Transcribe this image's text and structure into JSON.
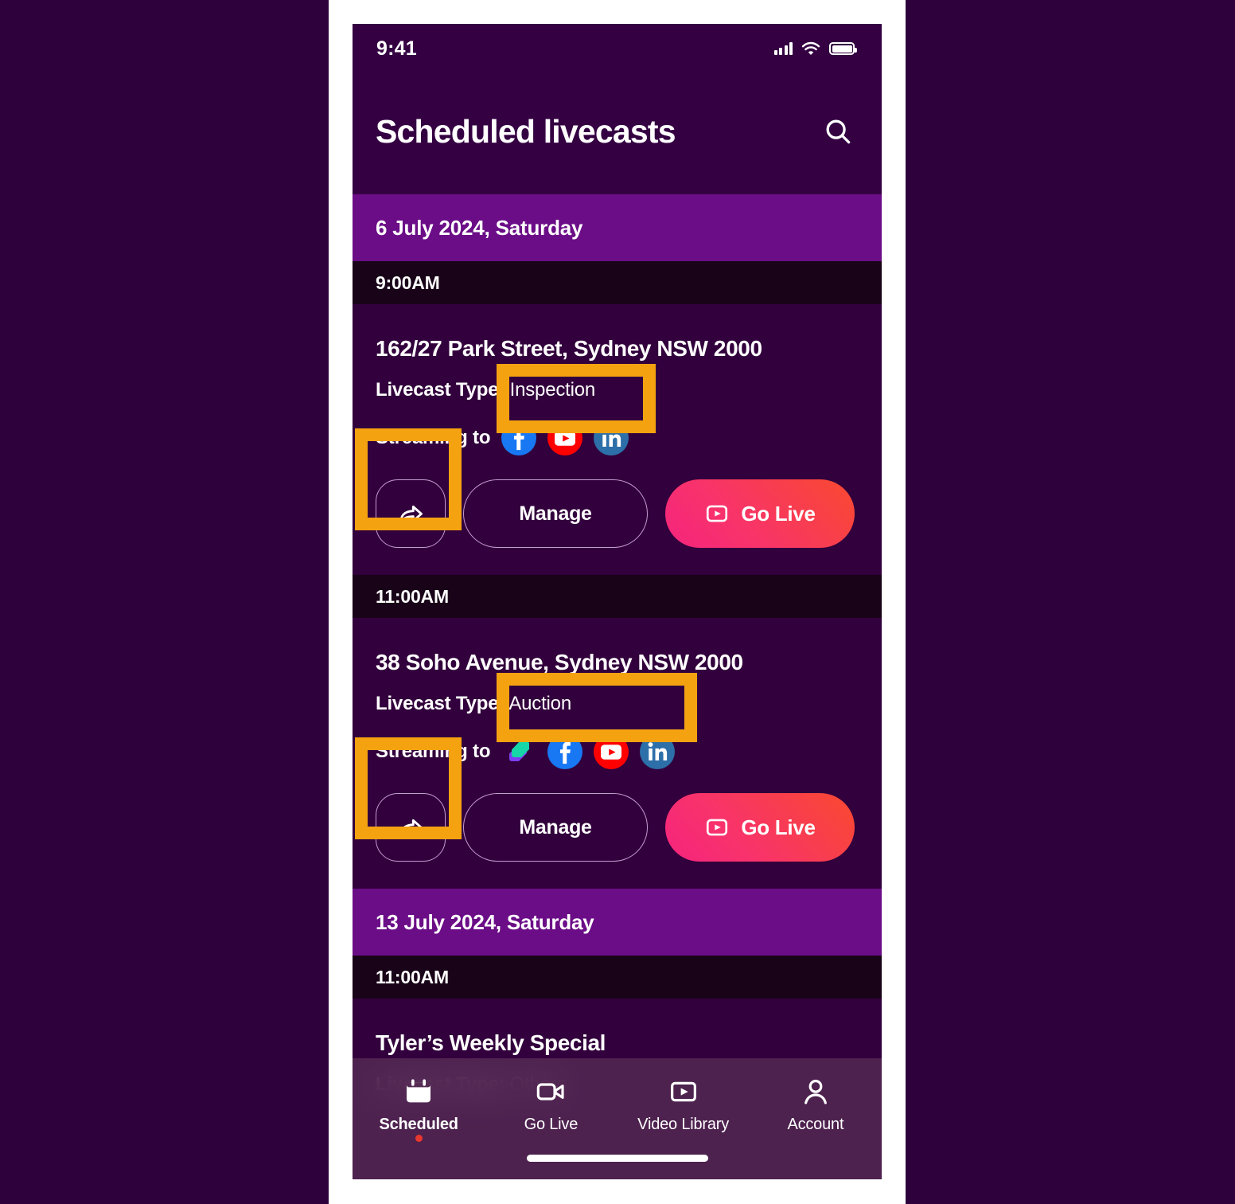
{
  "status_bar": {
    "time": "9:41",
    "cellular_icon": "signal-bars-icon",
    "wifi_icon": "wifi-icon",
    "battery_icon": "battery-full-icon"
  },
  "header": {
    "title": "Scheduled livecasts",
    "search_icon": "search-icon"
  },
  "colors": {
    "page_background": "#2E003C",
    "screen_background": "#32003C",
    "header_background": "#340042",
    "date_header_background": "#6B0D87",
    "time_row_background": "#190318",
    "accent_gradient_start": "#F5247E",
    "accent_gradient_end": "#F9492F",
    "annotation_highlight": "#F5A210",
    "badge_dot": "#E8382E",
    "facebook": "#1877F2",
    "youtube": "#FF0000",
    "linkedin": "#2D6FA8"
  },
  "sections": [
    {
      "date": "6 July 2024, Saturday",
      "entries": [
        {
          "time": "9:00AM",
          "title": "162/27 Park Street, Sydney NSW 2000",
          "type_label": "Livecast Type:",
          "type_value": "Inspection",
          "streaming_label": "Streaming to",
          "platforms": [
            "facebook",
            "youtube",
            "linkedin"
          ],
          "share_icon": "share-arrow-icon",
          "manage_label": "Manage",
          "golive_label": "Go Live",
          "golive_icon": "play-box-icon"
        },
        {
          "time": "11:00AM",
          "title": "38 Soho Avenue, Sydney NSW 2000",
          "type_label": "Livecast Type:",
          "type_value": "Auction",
          "streaming_label": "Streaming to",
          "platforms": [
            "domain",
            "facebook",
            "youtube",
            "linkedin"
          ],
          "share_icon": "share-arrow-icon",
          "manage_label": "Manage",
          "golive_label": "Go Live",
          "golive_icon": "play-box-icon"
        }
      ]
    },
    {
      "date": "13 July 2024, Saturday",
      "entries": [
        {
          "time": "11:00AM",
          "title": "Tyler’s Weekly Special",
          "type_label": "Livecast Type:",
          "type_value": "Others"
        }
      ]
    }
  ],
  "tab_bar": {
    "tabs": [
      {
        "label": "Scheduled",
        "icon": "calendar-icon",
        "active": true,
        "badge": true
      },
      {
        "label": "Go Live",
        "icon": "video-camera-icon",
        "active": false,
        "badge": false
      },
      {
        "label": "Video Library",
        "icon": "play-box-icon",
        "active": false,
        "badge": false
      },
      {
        "label": "Account",
        "icon": "person-icon",
        "active": false,
        "badge": false
      }
    ]
  }
}
